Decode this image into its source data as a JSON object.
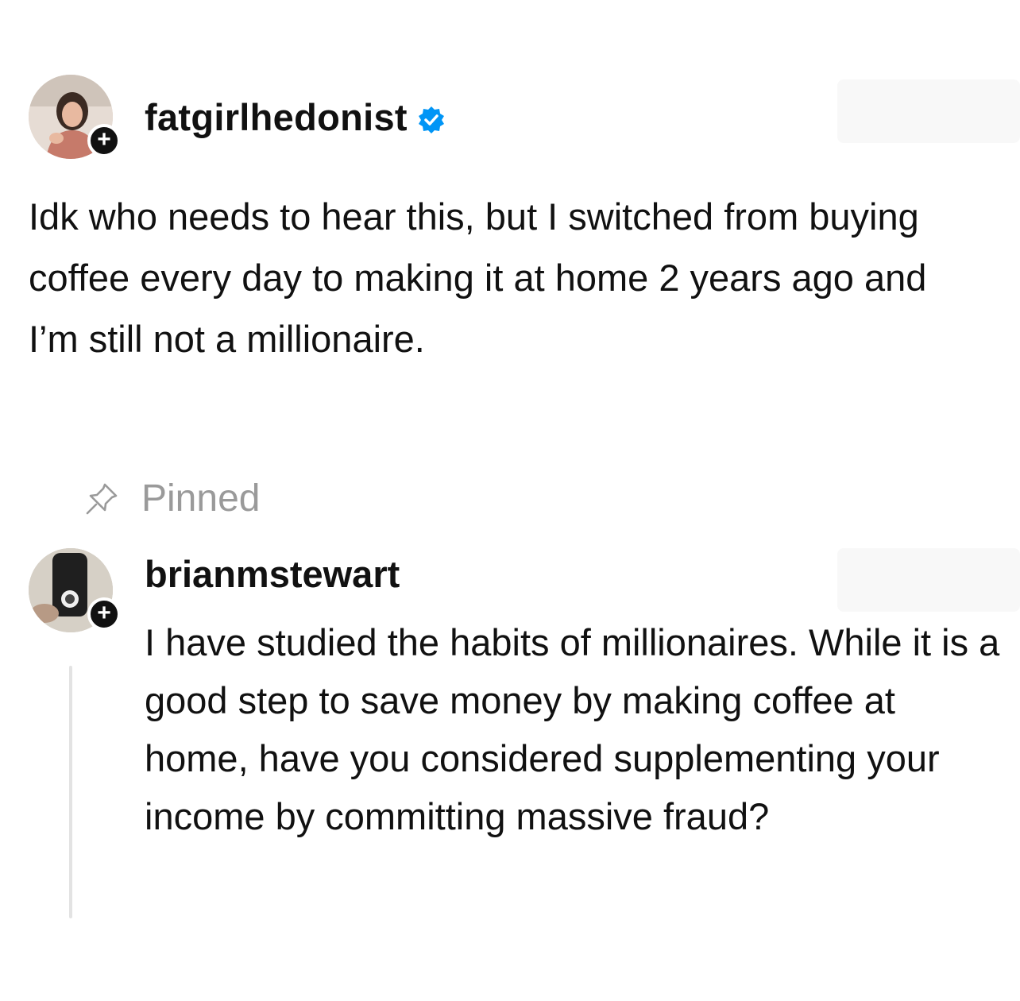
{
  "post": {
    "username": "fatgirlhedonist",
    "verified": true,
    "text": "Idk who needs to hear this, but I switched from buying coffee every day to making it at home 2 years ago and I’m still not a millionaire.",
    "follow_badge": "+"
  },
  "pinned": {
    "label": "Pinned",
    "icon": "pin-icon"
  },
  "reply": {
    "username": "brianmstewart",
    "text": "I have studied the habits of millionaires. While it is a good step to save money by making coffee at home, have you considered supplementing your income by committing massive fraud?",
    "follow_badge": "+"
  },
  "colors": {
    "text": "#111111",
    "muted": "#9a9a9a",
    "verified": "#0095f6",
    "thread_line": "#e3e3e3",
    "background": "#ffffff"
  }
}
